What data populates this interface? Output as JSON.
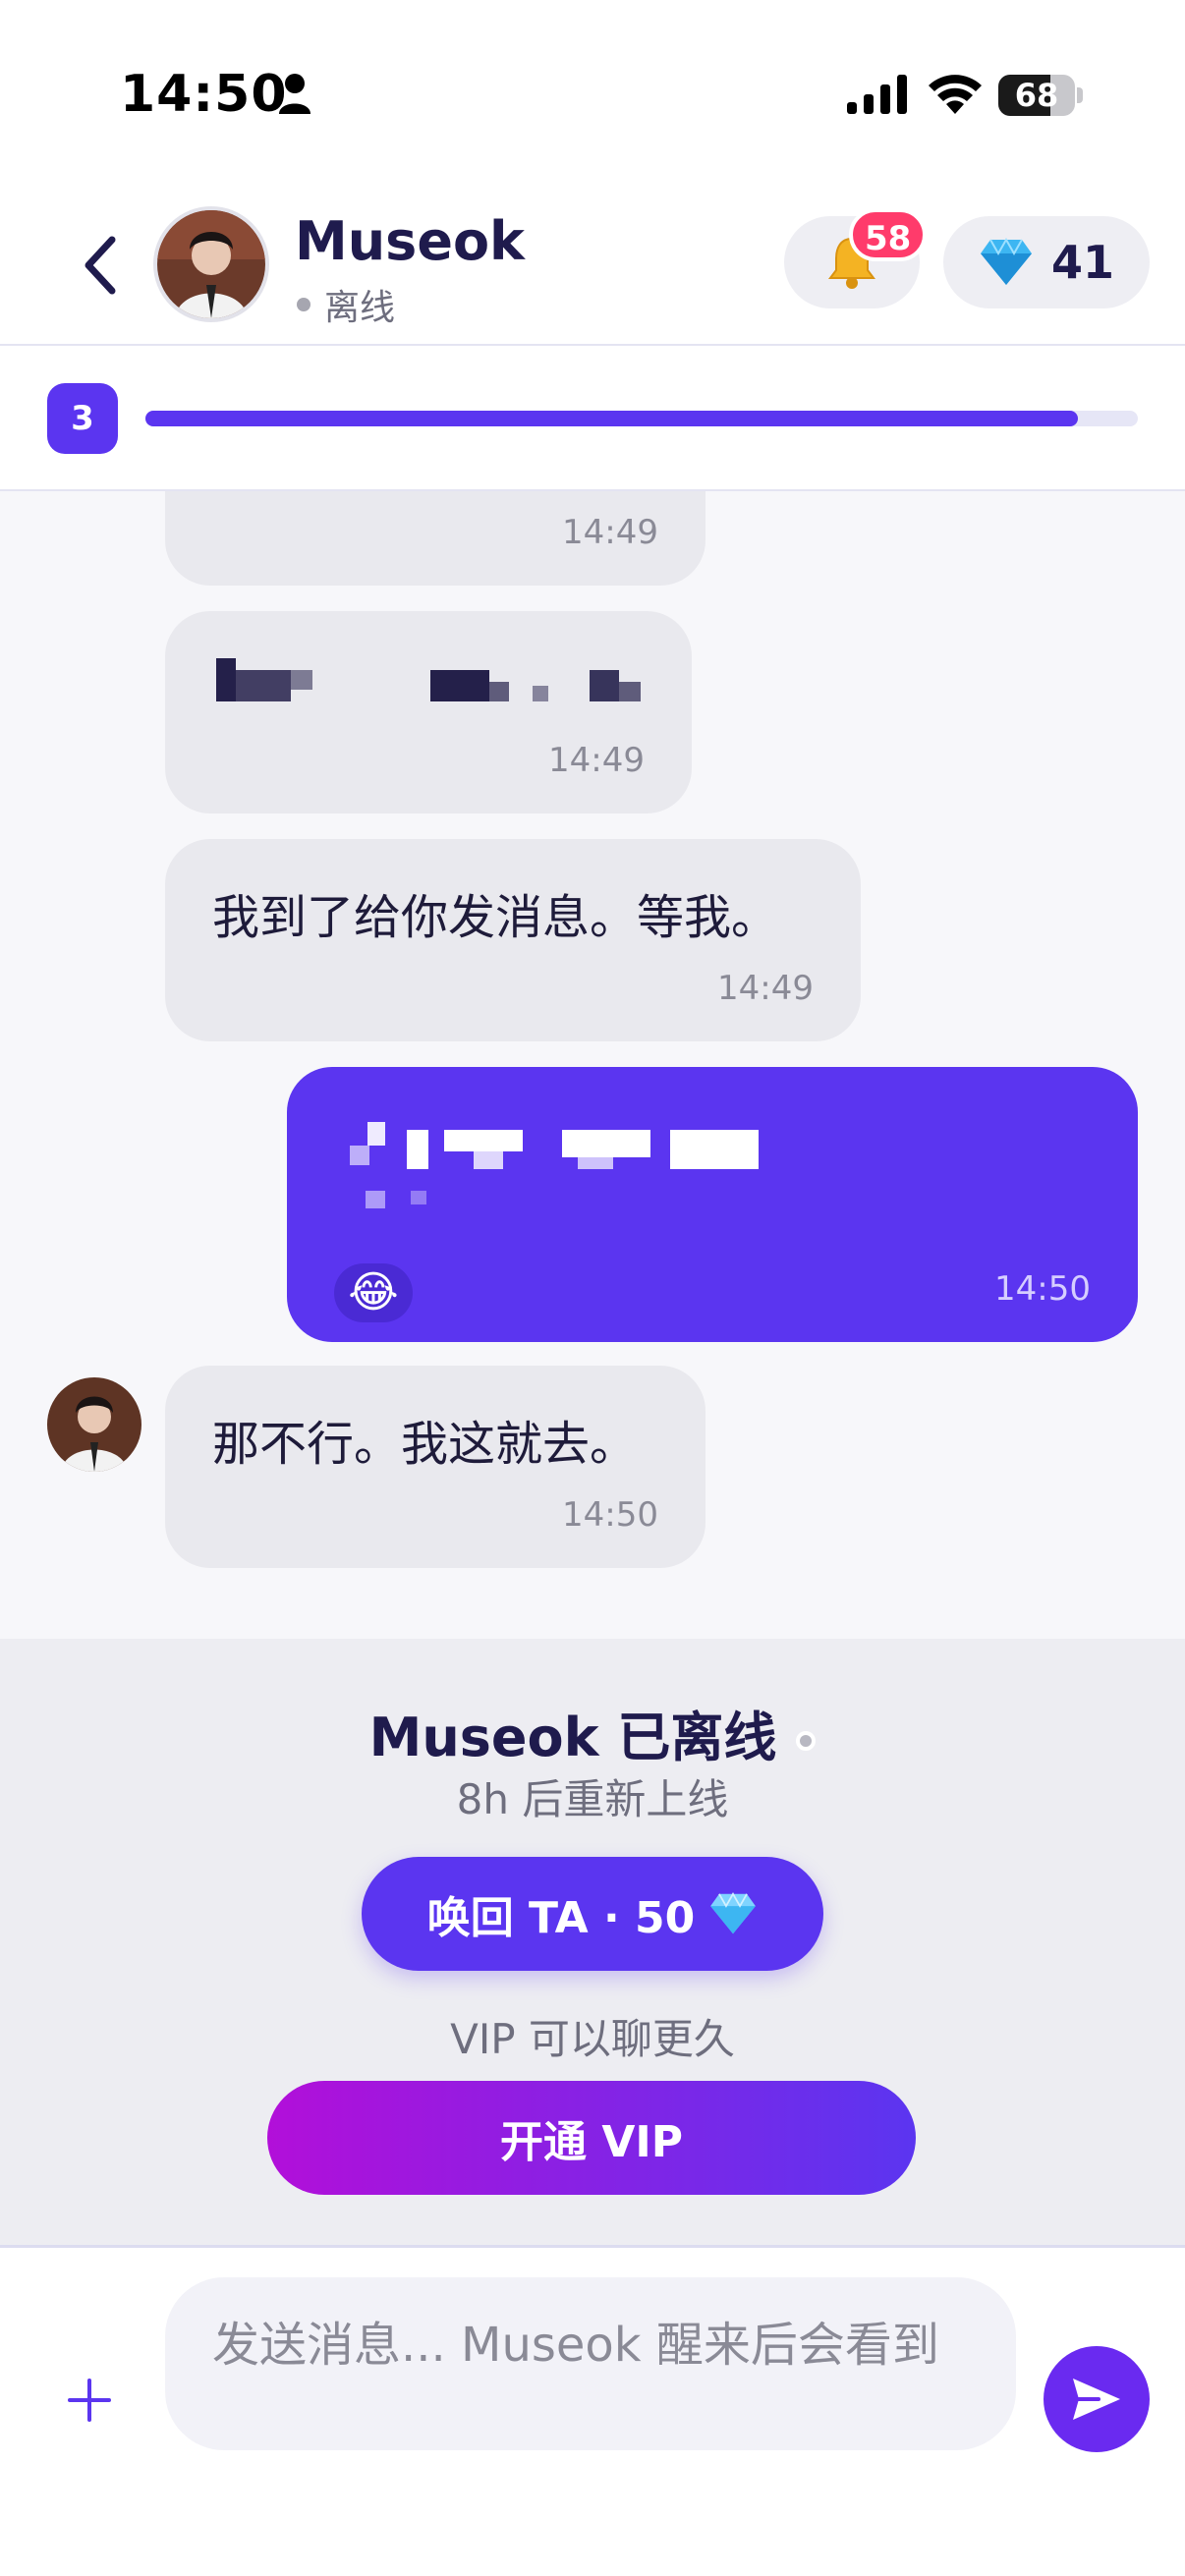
{
  "status_bar": {
    "time": "14:50",
    "battery": "68",
    "battery_fraction": 0.68
  },
  "header": {
    "contact_name": "Museok",
    "contact_status": "离线",
    "notifications_count": "58",
    "gems_count": "41"
  },
  "progress": {
    "level": "3",
    "fraction": 0.94
  },
  "messages": [
    {
      "side": "in",
      "text": "",
      "time": "14:49"
    },
    {
      "side": "in",
      "text": "",
      "time": "14:49"
    },
    {
      "side": "in",
      "text": "我到了给你发消息。等我。",
      "time": "14:49"
    },
    {
      "side": "out",
      "text": "",
      "emoji": "😂",
      "time": "14:50"
    },
    {
      "side": "in",
      "text": "那不行。我这就去。",
      "time": "14:50"
    }
  ],
  "offline_panel": {
    "title": "Museok 已离线",
    "subtitle": "8h 后重新上线",
    "recall_label": "唤回 TA · 50",
    "gem_icon": "💎",
    "vip_hint": "VIP 可以聊更久",
    "vip_button_label": "开通 VIP"
  },
  "composer": {
    "placeholder": "发送消息... Museok 醒来后会看到"
  },
  "colors": {
    "accent": "#5b35f0",
    "badge": "#ff3b6b",
    "vip_gradient_start": "#b20fd9"
  },
  "icons": {
    "back": "chevron-left-icon",
    "bell": "bell-icon",
    "gem": "gem-icon",
    "plus": "plus-icon",
    "send": "send-icon"
  }
}
